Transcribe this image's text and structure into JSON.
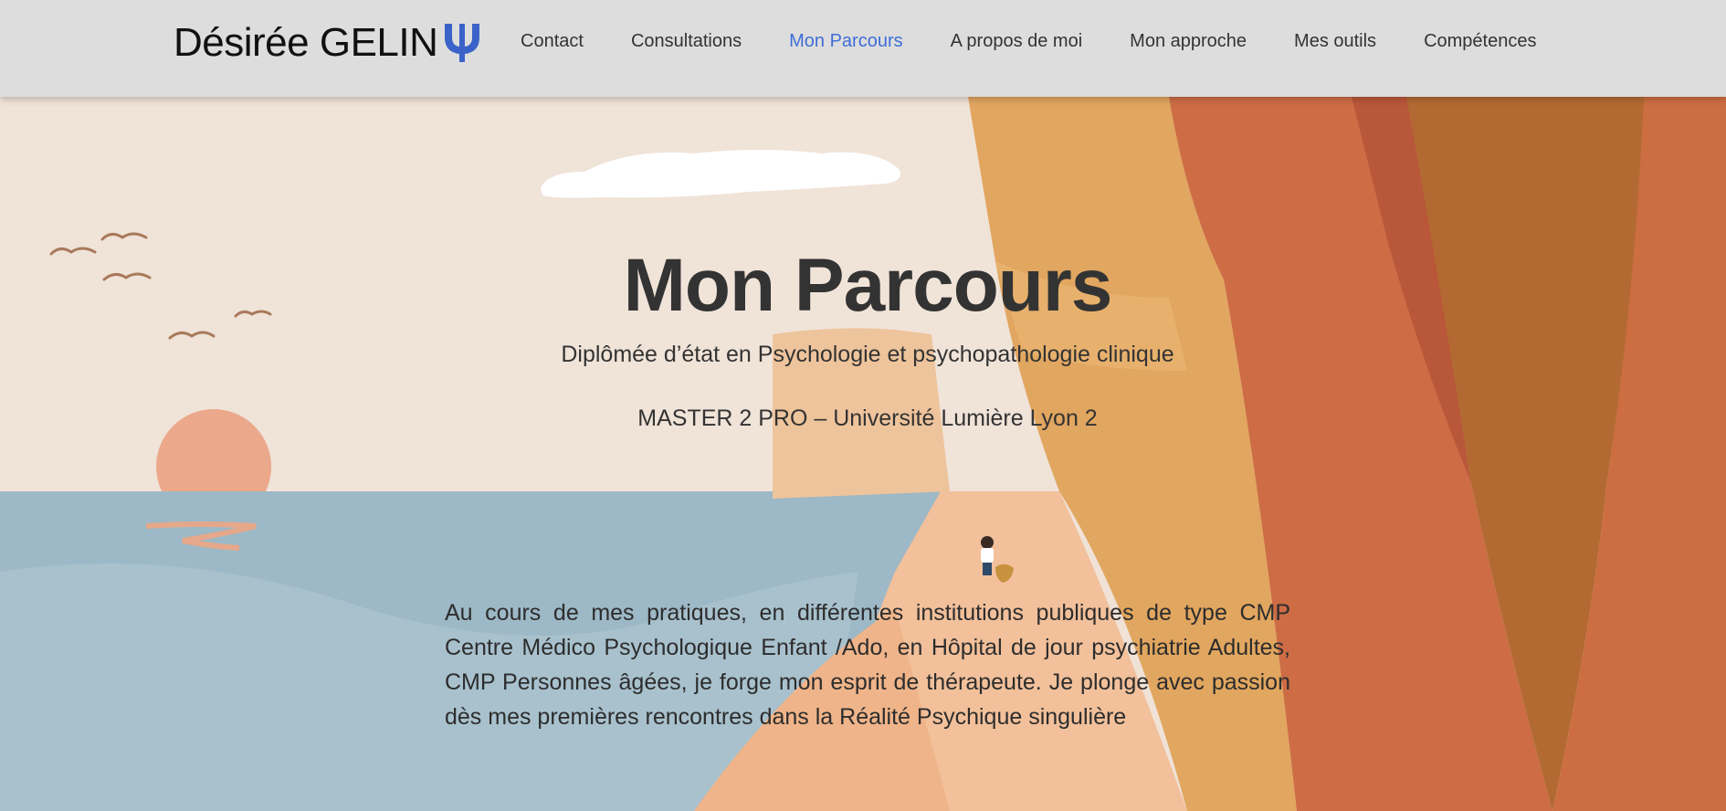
{
  "brand": {
    "name": "Désirée GELIN",
    "logo_icon": "psi-icon"
  },
  "nav": {
    "items": [
      {
        "label": "Contact"
      },
      {
        "label": "Consultations"
      },
      {
        "label": "Mon Parcours",
        "active": true
      },
      {
        "label": "A propos de moi"
      },
      {
        "label": "Mon approche"
      },
      {
        "label": "Mes outils"
      },
      {
        "label": "Compétences"
      }
    ]
  },
  "hero": {
    "title": "Mon Parcours",
    "subtitle": "Diplômée d’état en Psychologie et psychopathologie clinique",
    "degree": "MASTER 2 PRO – Université Lumière Lyon 2"
  },
  "content": {
    "paragraph": "Au cours de mes pratiques, en différentes institutions publiques de type CMP Centre Médico Psychologique Enfant /Ado, en Hôpital de jour psychiatrie Adultes, CMP Personnes âgées, je forge mon esprit de thérapeute. Je plonge avec passion dès mes premières rencontres dans la Réalité Psychique singulière"
  },
  "colors": {
    "accent": "#3f6ed6",
    "header_bg": "#dddddd",
    "text": "#333333"
  }
}
